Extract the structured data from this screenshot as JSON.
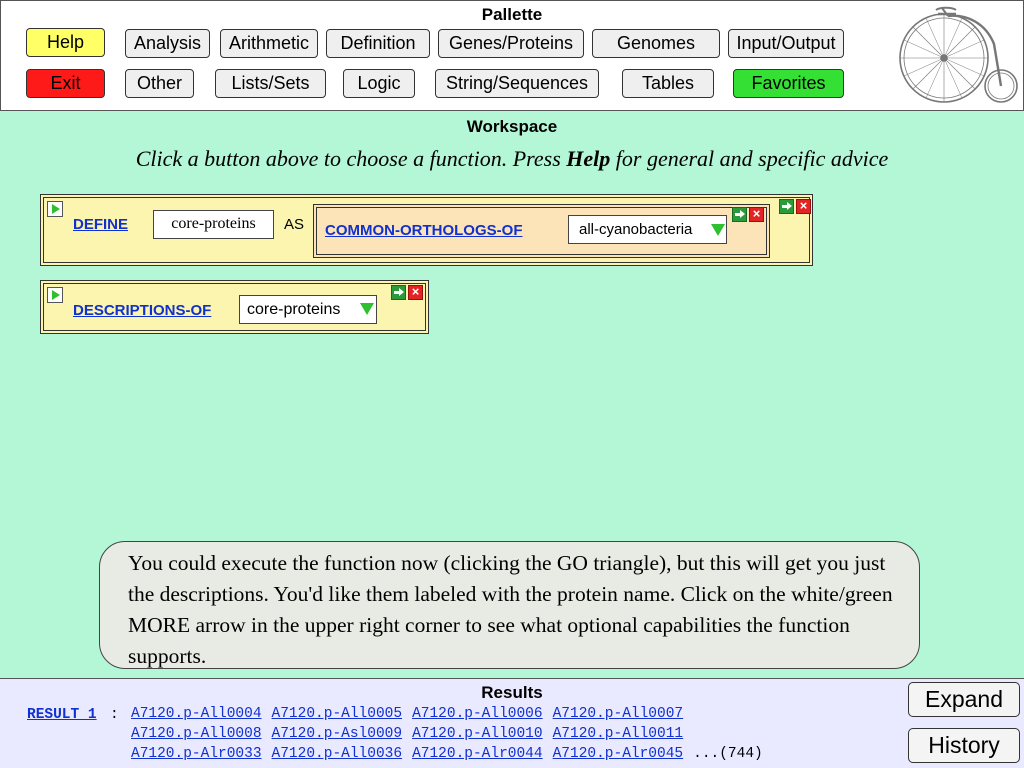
{
  "pallette": {
    "title": "Pallette",
    "help": "Help",
    "exit": "Exit",
    "row1": [
      "Analysis",
      "Arithmetic",
      "Definition",
      "Genes/Proteins",
      "Genomes",
      "Input/Output"
    ],
    "row2": [
      "Other",
      "Lists/Sets",
      "Logic",
      "String/Sequences",
      "Tables",
      "Favorites"
    ],
    "colors": {
      "help": "#ffff66",
      "exit": "#ff1a1a",
      "favorites": "#33e033"
    }
  },
  "workspace": {
    "title": "Workspace",
    "instruction_a": "Click a button above to choose a function. Press ",
    "instruction_help": "Help",
    "instruction_b": " for general and specific advice",
    "define_box": {
      "keyword": "DEFINE",
      "name_value": "core-proteins",
      "as": "AS",
      "inner_function": "COMMON-ORTHOLOGS-OF",
      "inner_arg": "all-cyanobacteria"
    },
    "desc_box": {
      "function": "DESCRIPTIONS-OF",
      "arg": "core-proteins"
    },
    "tip": "You could execute the function now (clicking the GO triangle), but this will get you just the descriptions. You'd like them labeled with the protein name. Click on the white/green MORE arrow in the upper right corner to see what optional capabilities the function supports."
  },
  "results": {
    "title": "Results",
    "label": "RESULT 1",
    "colon": ":",
    "rows": [
      [
        "A7120.p-All0004",
        "A7120.p-All0005",
        "A7120.p-All0006",
        "A7120.p-All0007"
      ],
      [
        "A7120.p-All0008",
        "A7120.p-Asl0009",
        "A7120.p-All0010",
        "A7120.p-All0011"
      ],
      [
        "A7120.p-Alr0033",
        "A7120.p-All0036",
        "A7120.p-Alr0044",
        "A7120.p-Alr0045"
      ]
    ],
    "more": "...(744)",
    "expand": "Expand",
    "history": "History"
  }
}
